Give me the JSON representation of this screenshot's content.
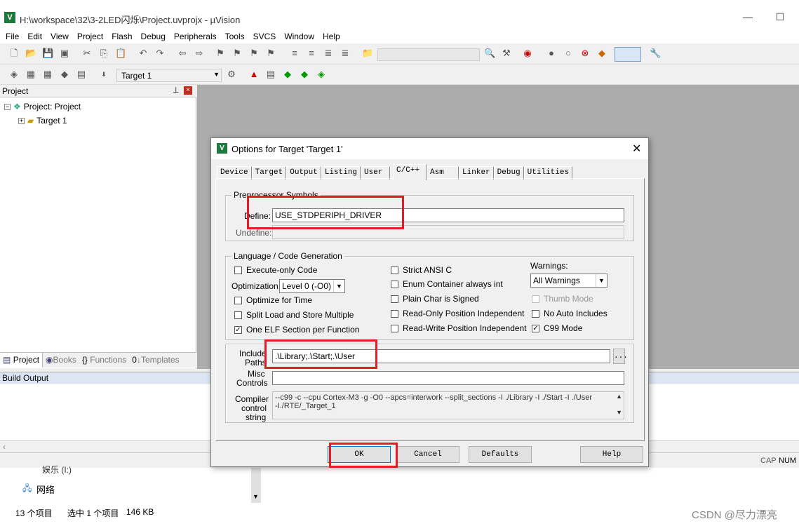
{
  "window": {
    "title": "H:\\workspace\\32\\3-2LED闪烁\\Project.uvprojx - µVision",
    "minimize": "—",
    "maximize": "☐"
  },
  "menu": [
    "File",
    "Edit",
    "View",
    "Project",
    "Flash",
    "Debug",
    "Peripherals",
    "Tools",
    "SVCS",
    "Window",
    "Help"
  ],
  "toolbar2": {
    "target_select": "Target 1"
  },
  "project_panel": {
    "title": "Project",
    "tree_root": "Project: Project",
    "tree_child": "Target 1",
    "tabs": [
      "Project",
      "Books",
      "Functions",
      "Templates"
    ]
  },
  "build_output": {
    "title": "Build Output"
  },
  "status": {
    "cap": "CAP",
    "num": "NUM"
  },
  "explorer": {
    "item_partial": "娱乐 (I:)",
    "network": "网络",
    "count": "13 个项目",
    "selected": "选中 1 个项目",
    "size": "146 KB",
    "watermark": "CSDN @尽力漂亮"
  },
  "dialog": {
    "title": "Options for Target 'Target 1'",
    "close": "✕",
    "tabs": [
      "Device",
      "Target",
      "Output",
      "Listing",
      "User",
      "C/C++",
      "Asm",
      "Linker",
      "Debug",
      "Utilities"
    ],
    "active_tab": "C/C++",
    "preprocessor": {
      "legend": "Preprocessor Symbols",
      "define_label": "Define:",
      "define_value": "USE_STDPERIPH_DRIVER",
      "undefine_label": "Undefine:",
      "undefine_value": ""
    },
    "language": {
      "legend": "Language / Code Generation",
      "execute_only": "Execute-only Code",
      "optimization_label": "Optimization:",
      "optimization_value": "Level 0 (-O0)",
      "optimize_time": "Optimize for Time",
      "split_load": "Split Load and Store Multiple",
      "one_elf": "One ELF Section per Function",
      "strict_ansi": "Strict ANSI C",
      "enum_container": "Enum Container always int",
      "plain_char": "Plain Char is Signed",
      "ro_pos": "Read-Only Position Independent",
      "rw_pos": "Read-Write Position Independent",
      "warnings_label": "Warnings:",
      "warnings_value": "All Warnings",
      "thumb_mode": "Thumb Mode",
      "no_auto": "No Auto Includes",
      "c99": "C99 Mode"
    },
    "include": {
      "label1": "Include",
      "label2": "Paths",
      "value": ".\\Library;.\\Start;.\\User",
      "browse": "..."
    },
    "misc": {
      "label1": "Misc",
      "label2": "Controls",
      "value": ""
    },
    "compiler": {
      "label1": "Compiler",
      "label2": "control",
      "label3": "string",
      "line1": "--c99 -c --cpu Cortex-M3 -g -O0 --apcs=interwork --split_sections -I ./Library -I ./Start -I ./User",
      "line2": "-I./RTE/_Target_1"
    },
    "buttons": {
      "ok": "OK",
      "cancel": "Cancel",
      "defaults": "Defaults",
      "help": "Help"
    }
  }
}
